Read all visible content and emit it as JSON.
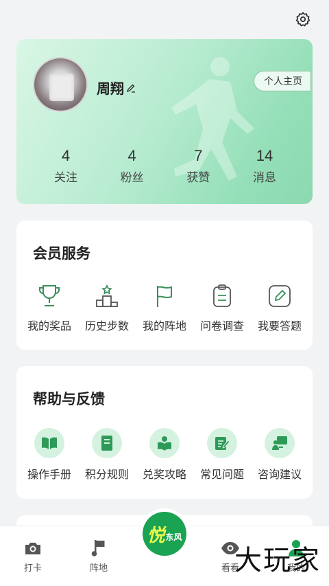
{
  "profile": {
    "username": "周翔",
    "homepage_label": "个人主页",
    "stats": [
      {
        "value": "4",
        "label": "关注"
      },
      {
        "value": "4",
        "label": "粉丝"
      },
      {
        "value": "7",
        "label": "获赞"
      },
      {
        "value": "14",
        "label": "消息"
      }
    ]
  },
  "member_services": {
    "title": "会员服务",
    "items": [
      {
        "label": "我的奖品",
        "icon": "trophy-icon"
      },
      {
        "label": "历史步数",
        "icon": "podium-icon"
      },
      {
        "label": "我的阵地",
        "icon": "flag-icon"
      },
      {
        "label": "问卷调查",
        "icon": "clipboard-icon"
      },
      {
        "label": "我要答题",
        "icon": "pencil-icon"
      }
    ]
  },
  "help_feedback": {
    "title": "帮助与反馈",
    "items": [
      {
        "label": "操作手册",
        "icon": "book-open-icon"
      },
      {
        "label": "积分规则",
        "icon": "book-icon"
      },
      {
        "label": "兑奖攻略",
        "icon": "reader-icon"
      },
      {
        "label": "常见问题",
        "icon": "edit-note-icon"
      },
      {
        "label": "咨询建议",
        "icon": "presenter-icon"
      }
    ]
  },
  "tabbar": {
    "tabs": [
      {
        "label": "打卡",
        "icon": "camera-icon"
      },
      {
        "label": "阵地",
        "icon": "flag-music-icon"
      },
      {
        "label": "",
        "icon": "app-logo"
      },
      {
        "label": "看看",
        "icon": "eye-icon"
      },
      {
        "label": "我的",
        "icon": "person-icon"
      }
    ],
    "logo_big": "悦",
    "logo_small": "东风"
  },
  "watermark": "大玩家",
  "colors": {
    "accent": "#1aa352",
    "icon_green": "#3a8f5b",
    "circle_bg": "#d4f2df"
  }
}
